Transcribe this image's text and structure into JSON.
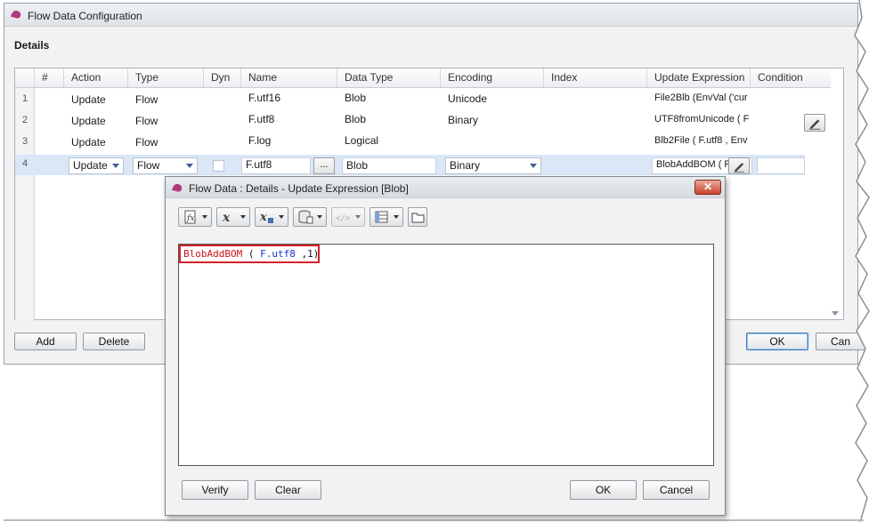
{
  "main_window": {
    "title": "Flow Data Configuration",
    "section_title": "Details",
    "columns": [
      "#",
      "Action",
      "Type",
      "Dyn",
      "Name",
      "Data Type",
      "Encoding",
      "Index",
      "Update Expression",
      "Condition"
    ],
    "rows": [
      {
        "num": "1",
        "action": "Update",
        "type": "Flow",
        "name": "F.utf16",
        "data_type": "Blob",
        "encoding": "Unicode",
        "update_expression": "File2Blb (EnvVal ('cur"
      },
      {
        "num": "2",
        "action": "Update",
        "type": "Flow",
        "name": "F.utf8",
        "data_type": "Blob",
        "encoding": "Binary",
        "update_expression": "UTF8fromUnicode ( F"
      },
      {
        "num": "3",
        "action": "Update",
        "type": "Flow",
        "name": "F.log",
        "data_type": "Logical",
        "encoding": "",
        "update_expression": "Blb2File ( F.utf8 , Env"
      },
      {
        "num": "4",
        "action": "Update",
        "type": "Flow",
        "name": "F.utf8",
        "data_type": "Blob",
        "encoding": "Binary",
        "update_expression": "BlobAddBOM ( F"
      }
    ],
    "ellipsis_label": "...",
    "buttons": {
      "add": "Add",
      "delete": "Delete",
      "ok": "OK",
      "cancel": "Can"
    }
  },
  "dialog": {
    "title": "Flow Data : Details - Update Expression [Blob]",
    "close_label": "✕",
    "toolbar_icons": [
      "function-doc-icon",
      "function-x-icon",
      "variable-x-icon",
      "database-icon",
      "code-tag-icon",
      "table-list-icon",
      "folder-icon"
    ],
    "expression": {
      "fn": "BlobAddBOM",
      "open": " ( ",
      "field": "F.utf8",
      "rest": " ,1)"
    },
    "buttons": {
      "verify": "Verify",
      "clear": "Clear",
      "ok": "OK",
      "cancel": "Cancel"
    }
  },
  "colors": {
    "accent": "#3b7bbf",
    "selected_row": "#dbe7f7",
    "expression_highlight": "#d3232b",
    "app_icon": "#b03a7e"
  }
}
